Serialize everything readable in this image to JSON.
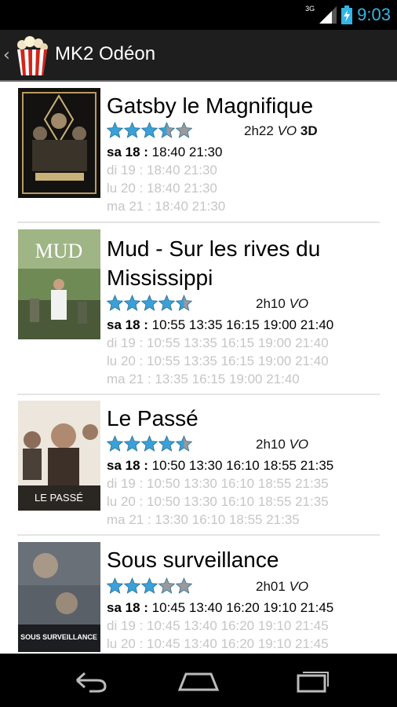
{
  "status": {
    "network": "3G",
    "time": "9:03"
  },
  "actionbar": {
    "title": "MK2 Odéon"
  },
  "movies": [
    {
      "title": "Gatsby le Magnifique",
      "rating": 3.5,
      "duration": "2h22",
      "version": "VO",
      "format": "3D",
      "poster_colors": [
        "#1a1712",
        "#c8b27a"
      ],
      "showtimes": [
        {
          "day": "sa 18",
          "sep": " : ",
          "times": "18:40 21:30"
        },
        {
          "day": "di 19",
          "sep": " : ",
          "times": "18:40 21:30"
        },
        {
          "day": "lu 20",
          "sep": " : ",
          "times": "18:40 21:30"
        },
        {
          "day": "ma 21",
          "sep": " : ",
          "times": "18:40 21:30"
        }
      ]
    },
    {
      "title_line1": "Mud - Sur les rives du",
      "title_line2": "Mississippi",
      "rating": 4.5,
      "duration": "2h10",
      "version": "VO",
      "poster_colors": [
        "#4e6a3a",
        "#9bb07e"
      ],
      "showtimes": [
        {
          "day": "sa 18",
          "sep": " : ",
          "times": "10:55 13:35 16:15 19:00 21:40"
        },
        {
          "day": "di 19",
          "sep": " : ",
          "times": "10:55 13:35 16:15 19:00 21:40"
        },
        {
          "day": "lu 20",
          "sep": " : ",
          "times": "10:55 13:35 16:15 19:00 21:40"
        },
        {
          "day": "ma 21",
          "sep": " : ",
          "times": "13:35 16:15 19:00 21:40"
        }
      ]
    },
    {
      "title": "Le Passé",
      "rating": 4.5,
      "duration": "2h10",
      "version": "VO",
      "poster_colors": [
        "#e9e4dc",
        "#5a5046"
      ],
      "showtimes": [
        {
          "day": "sa 18",
          "sep": " : ",
          "times": "10:50 13:30 16:10 18:55 21:35"
        },
        {
          "day": "di 19",
          "sep": " : ",
          "times": "10:50 13:30 16:10 18:55 21:35"
        },
        {
          "day": "lu 20",
          "sep": " : ",
          "times": "10:50 13:30 16:10 18:55 21:35"
        },
        {
          "day": "ma 21",
          "sep": " : ",
          "times": "13:30 16:10 18:55 21:35"
        }
      ]
    },
    {
      "title": "Sous surveillance",
      "rating": 3,
      "duration": "2h01",
      "version": "VO",
      "poster_colors": [
        "#2c3036",
        "#8a8f95"
      ],
      "showtimes": [
        {
          "day": "sa 18",
          "sep": " : ",
          "times": "10:45 13:40 16:20 19:10 21:45"
        },
        {
          "day": "di 19",
          "sep": " : ",
          "times": "10:45 13:40 16:20 19:10 21:45"
        },
        {
          "day": "lu 20",
          "sep": " : ",
          "times": "10:45 13:40 16:20 19:10 21:45"
        }
      ]
    }
  ],
  "colors": {
    "star_on": "#3aa0d8",
    "star_off": "#9a9a9a",
    "accent": "#33b5e5"
  }
}
